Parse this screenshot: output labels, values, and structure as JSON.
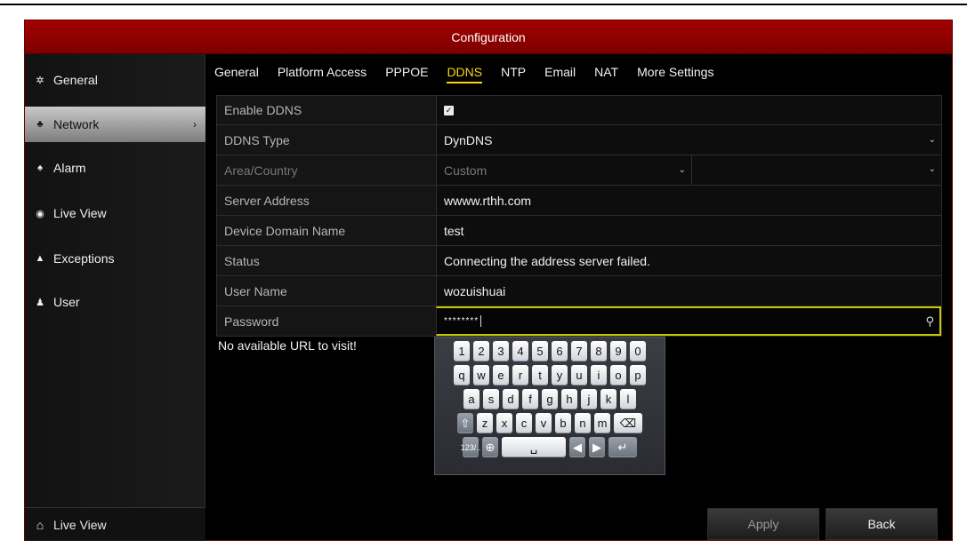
{
  "window": {
    "title": "Configuration"
  },
  "sidebar": {
    "items": [
      {
        "label": "General",
        "icon": "gear-icon",
        "glyph": "✲"
      },
      {
        "label": "Network",
        "icon": "network-icon",
        "glyph": "♣",
        "chevron": "›"
      },
      {
        "label": "Alarm",
        "icon": "alarm-icon",
        "glyph": "♠"
      },
      {
        "label": "Live View",
        "icon": "eye-icon",
        "glyph": "◉"
      },
      {
        "label": "Exceptions",
        "icon": "warning-icon",
        "glyph": "▲"
      },
      {
        "label": "User",
        "icon": "user-icon",
        "glyph": "♟"
      }
    ],
    "bottom": {
      "label": "Live View",
      "glyph": "⌂"
    }
  },
  "tabs": [
    "General",
    "Platform Access",
    "PPPOE",
    "DDNS",
    "NTP",
    "Email",
    "NAT",
    "More Settings"
  ],
  "active_tab": "DDNS",
  "form": {
    "enable_ddns": {
      "label": "Enable DDNS",
      "checked": true,
      "mark": "✓"
    },
    "ddns_type": {
      "label": "DDNS Type",
      "value": "DynDNS"
    },
    "area_country": {
      "label": "Area/Country",
      "value": "Custom",
      "value2": ""
    },
    "server_address": {
      "label": "Server Address",
      "value": "wwww.rthh.com"
    },
    "device_domain": {
      "label": "Device Domain Name",
      "value": "test"
    },
    "status": {
      "label": "Status",
      "value": "Connecting the address server failed."
    },
    "user_name": {
      "label": "User Name",
      "value": "wozuishuai"
    },
    "password": {
      "label": "Password",
      "value": "********"
    }
  },
  "message": "No available URL to visit!",
  "keyboard": {
    "row1": [
      "1",
      "2",
      "3",
      "4",
      "5",
      "6",
      "7",
      "8",
      "9",
      "0"
    ],
    "row2": [
      "q",
      "w",
      "e",
      "r",
      "t",
      "y",
      "u",
      "i",
      "o",
      "p"
    ],
    "row3": [
      "a",
      "s",
      "d",
      "f",
      "g",
      "h",
      "j",
      "k",
      "l"
    ],
    "row4": [
      "z",
      "x",
      "c",
      "v",
      "b",
      "n",
      "m"
    ],
    "shift": "⇧",
    "backspace": "⌫",
    "mode": "123/..",
    "globe": "⊕",
    "space": "␣",
    "left": "◀",
    "right": "▶",
    "enter": "↵"
  },
  "buttons": {
    "apply": "Apply",
    "back": "Back"
  },
  "colors": {
    "titlebar": "#8b0000",
    "active_tab": "#ffd21a",
    "focus": "#c8c800"
  }
}
